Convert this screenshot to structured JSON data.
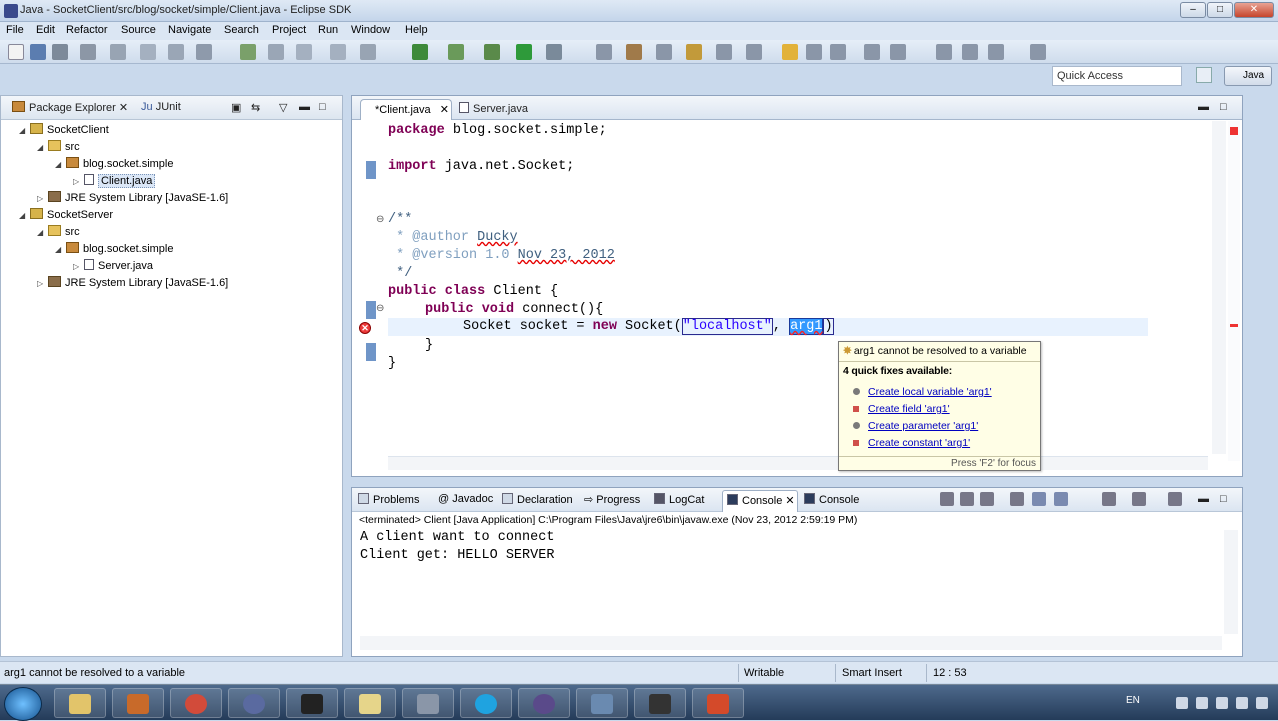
{
  "window": {
    "title": "Java - SocketClient/src/blog/socket/simple/Client.java - Eclipse SDK",
    "controls": {
      "minimize": "–",
      "maximize": "□",
      "close": "✕"
    }
  },
  "menu": [
    "File",
    "Edit",
    "Refactor",
    "Source",
    "Navigate",
    "Search",
    "Project",
    "Run",
    "Window",
    "Help"
  ],
  "quick_access": {
    "placeholder": "Quick Access"
  },
  "perspective": {
    "label": "Java"
  },
  "package_explorer": {
    "tabs": [
      "Package Explorer",
      "JUnit"
    ],
    "tree": [
      {
        "label": "SocketClient"
      },
      {
        "label": "src"
      },
      {
        "label": "blog.socket.simple"
      },
      {
        "label": "Client.java"
      },
      {
        "label": "JRE System Library",
        "suffix": "[JavaSE-1.6]"
      },
      {
        "label": "SocketServer"
      },
      {
        "label": "src"
      },
      {
        "label": "blog.socket.simple"
      },
      {
        "label": "Server.java"
      },
      {
        "label": "JRE System Library",
        "suffix": "[JavaSE-1.6]"
      }
    ]
  },
  "editor": {
    "tabs": [
      "*Client.java",
      "Server.java"
    ],
    "code": {
      "package_kw": "package",
      "package_name": " blog.socket.simple;",
      "import_kw": "import",
      "import_name": " java.net.Socket;",
      "javadoc_open": "/**",
      "author_tag": " * @author ",
      "author_name": "Ducky",
      "version_tag": " * @version 1.0 ",
      "version_date": "Nov 23, 2012",
      "javadoc_close": " */",
      "class_kw": "public class",
      "class_rest": " Client {",
      "method_kw": "public void",
      "method_rest": " connect(){",
      "stmt_start": "Socket socket = ",
      "new_kw": "new",
      "socket_ctor": " Socket(",
      "string_arg": "\"localhost\"",
      "comma": ", ",
      "bad_arg": "arg1",
      "stmt_end": ")",
      "close1": "}",
      "close2": "}"
    }
  },
  "quickfix": {
    "problem": "arg1 cannot be resolved to a variable",
    "count": "4 quick fixes available:",
    "fixes": [
      "Create local variable 'arg1'",
      "Create field 'arg1'",
      "Create parameter 'arg1'",
      "Create constant 'arg1'"
    ],
    "footer": "Press 'F2' for focus"
  },
  "console": {
    "tabs": [
      "Problems",
      "Javadoc",
      "Declaration",
      "Progress",
      "LogCat",
      "Console",
      "Console"
    ],
    "status": "<terminated> Client [Java Application] C:\\Program Files\\Java\\jre6\\bin\\javaw.exe (Nov 23, 2012 2:59:19 PM)",
    "lines": [
      "A client want to connect",
      "Client get: HELLO SERVER"
    ]
  },
  "statusbar": {
    "message": "arg1 cannot be resolved to a variable",
    "writable": "Writable",
    "insert_mode": "Smart Insert",
    "position": "12 : 53"
  },
  "taskbar": {
    "lang": "EN"
  }
}
